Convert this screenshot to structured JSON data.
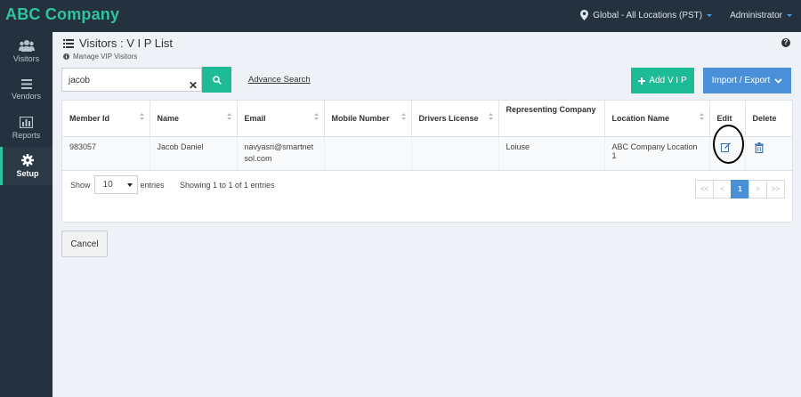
{
  "app": {
    "brand": "ABC Company"
  },
  "topbar": {
    "location": "Global - All Locations (PST)",
    "user": "Administrator"
  },
  "sidebar": {
    "items": [
      {
        "label": "Visitors",
        "icon": "users-icon"
      },
      {
        "label": "Vendors",
        "icon": "list-icon"
      },
      {
        "label": "Reports",
        "icon": "bar-chart-icon"
      },
      {
        "label": "Setup",
        "icon": "gear-icon",
        "active": true
      }
    ]
  },
  "page": {
    "title": "Visitors : V I P List",
    "subtitle": "Manage VIP Visitors",
    "help_icon": "?"
  },
  "search": {
    "value": "jacob",
    "clear_icon": "✕",
    "advance_label": "Advance Search"
  },
  "actions": {
    "add_label": "Add V I P",
    "import_label": "Import / Export"
  },
  "table": {
    "headers": [
      "Member Id",
      "Name",
      "Email",
      "Mobile Number",
      "Drivers License",
      "Representing Company",
      "Location Name",
      "Edit",
      "Delete"
    ],
    "rows": [
      {
        "member_id": "983057",
        "name": "Jacob Daniel",
        "email": "navyasri@smartnetsol.com",
        "mobile": "",
        "license": "",
        "company": "Loiuse",
        "location": "ABC Company Location 1"
      }
    ]
  },
  "footer": {
    "show_label": "Show",
    "page_size": "10",
    "entries_label": "entries",
    "info": "Showing 1 to 1 of 1 entries",
    "pager": {
      "first": "<<",
      "prev": "<",
      "current": "1",
      "next": ">",
      "last": ">>"
    }
  },
  "cancel_label": "Cancel",
  "colors": {
    "brand": "#2ec4a0",
    "accent_green": "#1ebc96",
    "accent_blue": "#4a90d9",
    "sidebar_bg": "#24313f"
  }
}
